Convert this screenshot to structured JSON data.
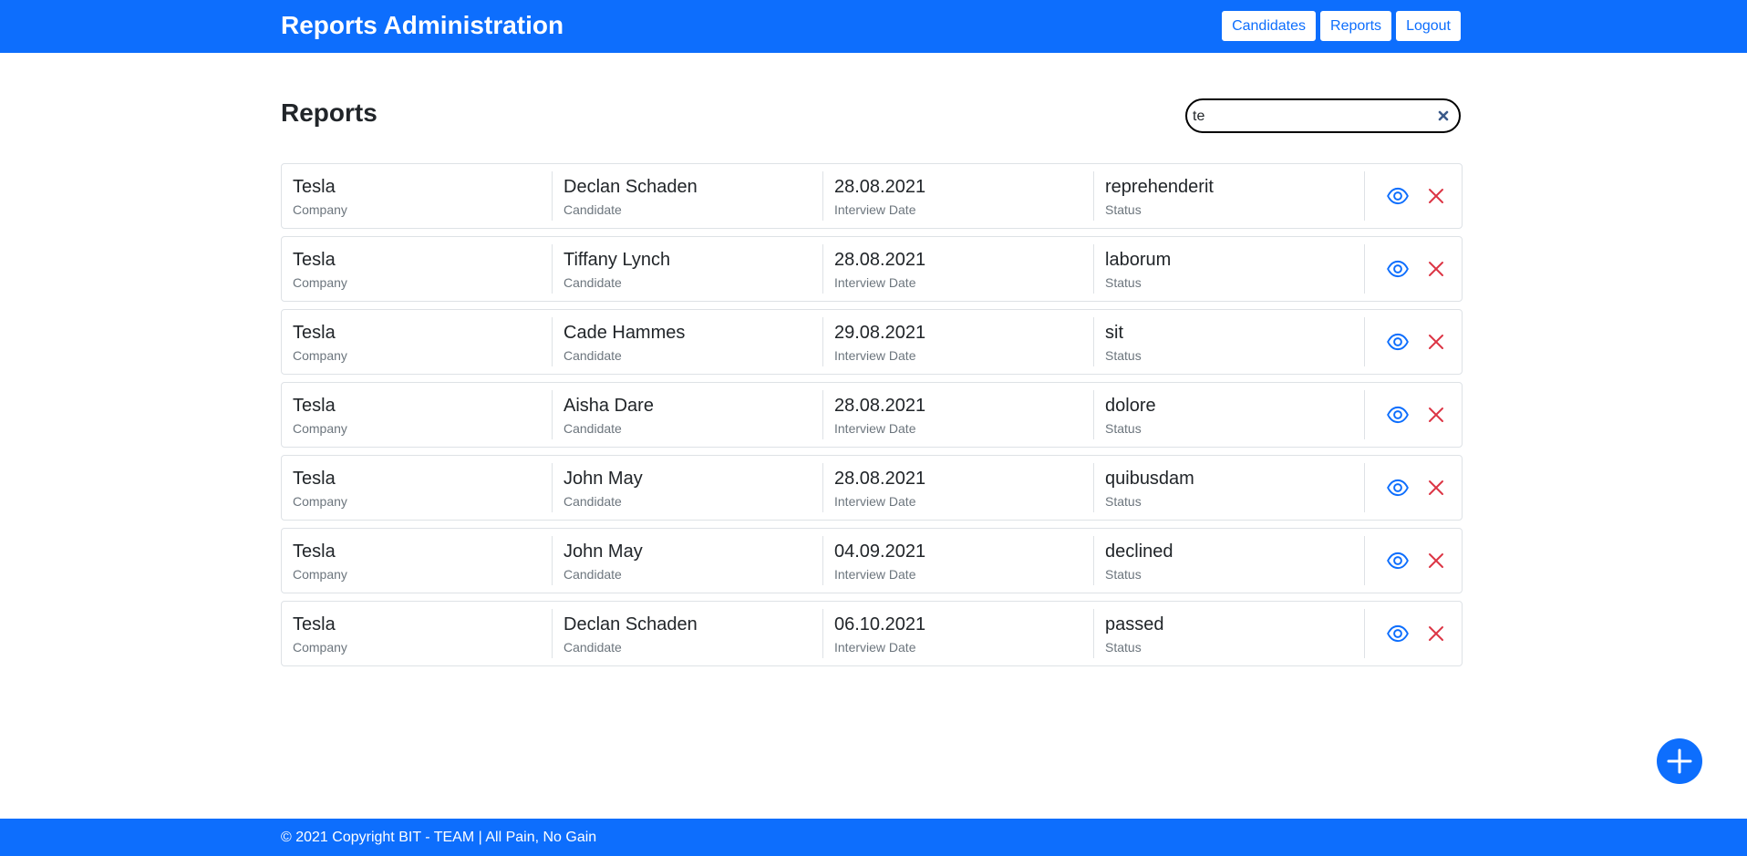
{
  "header": {
    "title": "Reports Administration",
    "nav": [
      {
        "label": "Candidates"
      },
      {
        "label": "Reports"
      },
      {
        "label": "Logout"
      }
    ]
  },
  "main": {
    "title": "Reports",
    "search": {
      "value": "te",
      "placeholder": ""
    },
    "labels": {
      "company": "Company",
      "candidate": "Candidate",
      "date": "Interview Date",
      "status": "Status"
    },
    "reports": [
      {
        "company": "Tesla",
        "candidate": "Declan Schaden",
        "date": "28.08.2021",
        "status": "reprehenderit"
      },
      {
        "company": "Tesla",
        "candidate": "Tiffany Lynch",
        "date": "28.08.2021",
        "status": "laborum"
      },
      {
        "company": "Tesla",
        "candidate": "Cade Hammes",
        "date": "29.08.2021",
        "status": "sit"
      },
      {
        "company": "Tesla",
        "candidate": "Aisha Dare",
        "date": "28.08.2021",
        "status": "dolore"
      },
      {
        "company": "Tesla",
        "candidate": "John May",
        "date": "28.08.2021",
        "status": "quibusdam"
      },
      {
        "company": "Tesla",
        "candidate": "John May",
        "date": "04.09.2021",
        "status": "declined"
      },
      {
        "company": "Tesla",
        "candidate": "Declan Schaden",
        "date": "06.10.2021",
        "status": "passed"
      }
    ]
  },
  "footer": {
    "text": "© 2021 Copyright BIT - TEAM | All Pain, No Gain"
  },
  "colors": {
    "primary": "#0d6efd",
    "danger": "#dc3545",
    "muted": "#6c757d"
  },
  "icons": {
    "view": "eye-icon",
    "delete": "close-icon",
    "add": "plus-icon",
    "clear": "close-icon"
  }
}
